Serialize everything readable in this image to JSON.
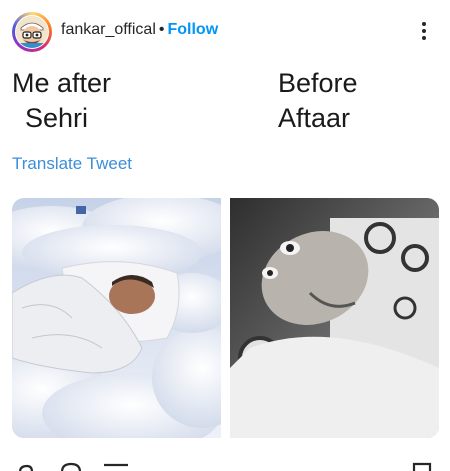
{
  "post": {
    "username": "fankar_offical",
    "separator": "•",
    "follow_label": "Follow"
  },
  "caption": {
    "left_line1": "Me after",
    "left_line2": "Sehri",
    "right_line1": "Before",
    "right_line2": "Aftaar"
  },
  "translate_label": "Translate Tweet",
  "icons": {
    "more": "more-vertical-icon",
    "like": "heart-icon",
    "comment": "comment-icon",
    "share": "share-icon",
    "save": "bookmark-icon"
  },
  "colors": {
    "follow_blue": "#0095f6",
    "translate_blue": "#3b8fd8",
    "text": "#262626"
  }
}
